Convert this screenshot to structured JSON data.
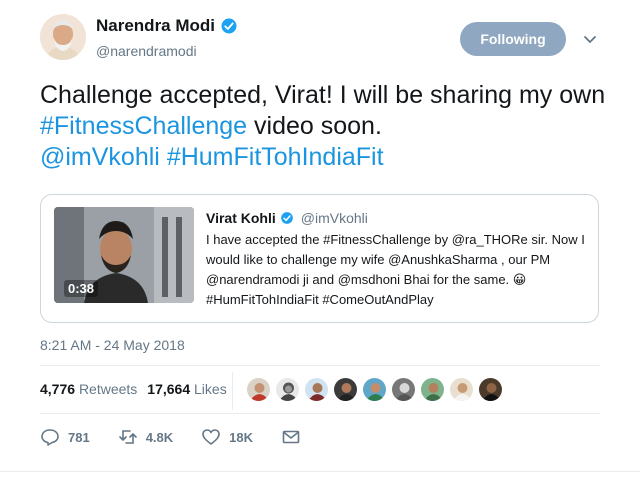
{
  "author": {
    "name": "Narendra Modi",
    "handle": "@narendramodi",
    "follow_label": "Following",
    "verified_color": "#1da1f2"
  },
  "tweet": {
    "text_plain": "Challenge accepted, Virat! I will be sharing my own ",
    "hashtag1": "#FitnessChallenge",
    "text_after": " video soon.",
    "mention": "@imVkohli",
    "hashtag2": "#HumFitTohIndiaFit"
  },
  "quote": {
    "name": "Virat Kohli",
    "handle": "@imVkohli",
    "duration": "0:38",
    "text": "I have accepted the #FitnessChallenge by @ra_THORe sir. Now I would like to challenge my wife @AnushkaSharma , our PM @narendramodi ji and @msdhoni Bhai for the same. 😀 #HumFitTohIndiaFit #ComeOutAndPlay"
  },
  "timestamp": "8:21 AM - 24 May 2018",
  "stats": {
    "retweets_count": "4,776",
    "retweets_label": "Retweets",
    "likes_count": "17,664",
    "likes_label": "Likes"
  },
  "actions": {
    "reply_count": "781",
    "retweet_count": "4.8K",
    "like_count": "18K"
  },
  "icons": [
    "verified-badge-icon",
    "chevron-down-icon",
    "reply-icon",
    "retweet-icon",
    "heart-icon",
    "direct-message-icon"
  ],
  "colors": {
    "link": "#1b95e0",
    "follow_button": "#8fa7c0",
    "muted": "#657786"
  }
}
